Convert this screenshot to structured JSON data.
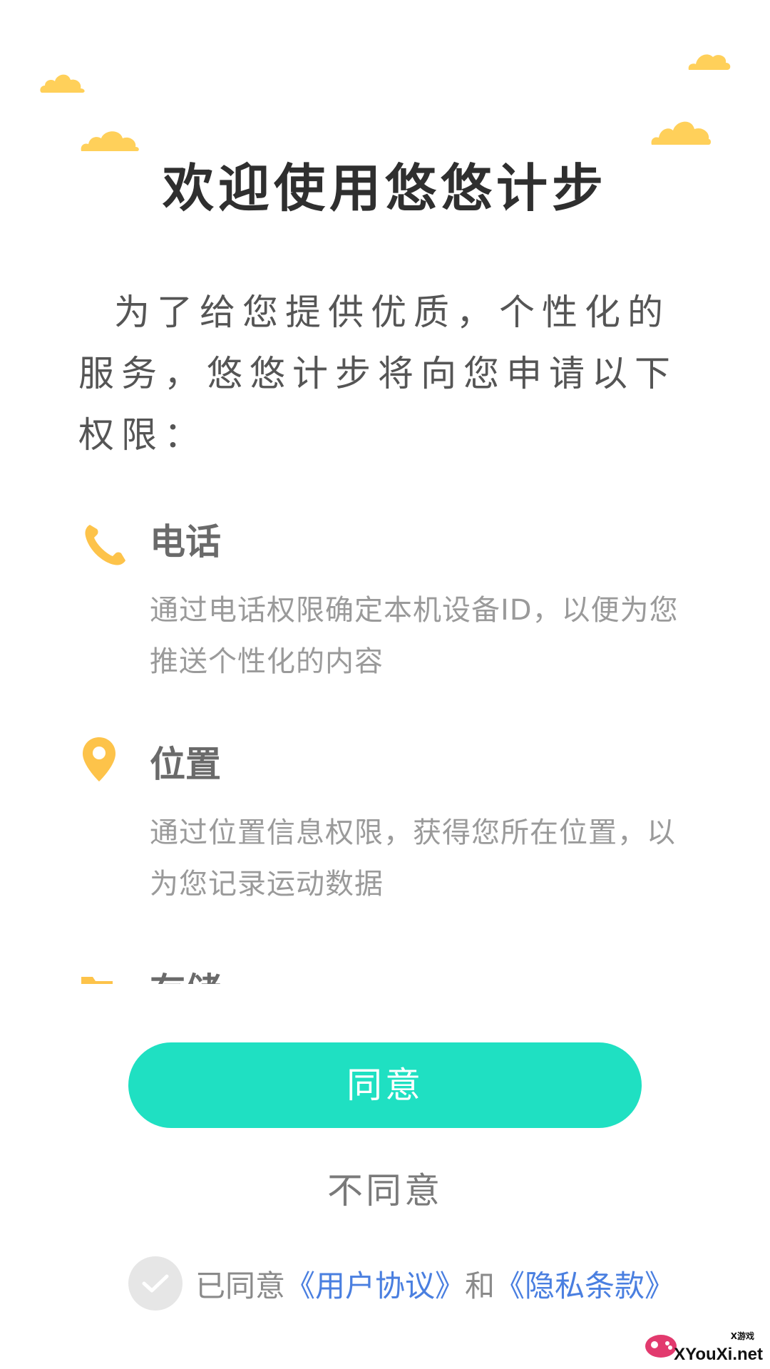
{
  "title": "欢迎使用悠悠计步",
  "intro": "为了给您提供优质，个性化的服务，悠悠计步将向您申请以下权限：",
  "permissions": [
    {
      "icon": "phone-icon",
      "title": "电话",
      "description": "通过电话权限确定本机设备ID，以便为您推送个性化的内容"
    },
    {
      "icon": "location-pin-icon",
      "title": "位置",
      "description": "通过位置信息权限，获得您所在位置，以为您记录运动数据"
    },
    {
      "icon": "folder-icon",
      "title": "存储",
      "description": ""
    }
  ],
  "buttons": {
    "agree": "同意",
    "disagree": "不同意"
  },
  "consent": {
    "prefix": "已同意",
    "user_agreement": "《用户协议》",
    "and": "和",
    "privacy_terms": "《隐私条款》"
  },
  "watermark": {
    "small": "X游戏",
    "text": "XYouXi.net"
  },
  "colors": {
    "accent": "#1fe0c2",
    "cloud": "#ffd05a",
    "icon": "#fdc34a",
    "link": "#4a7fe0"
  }
}
